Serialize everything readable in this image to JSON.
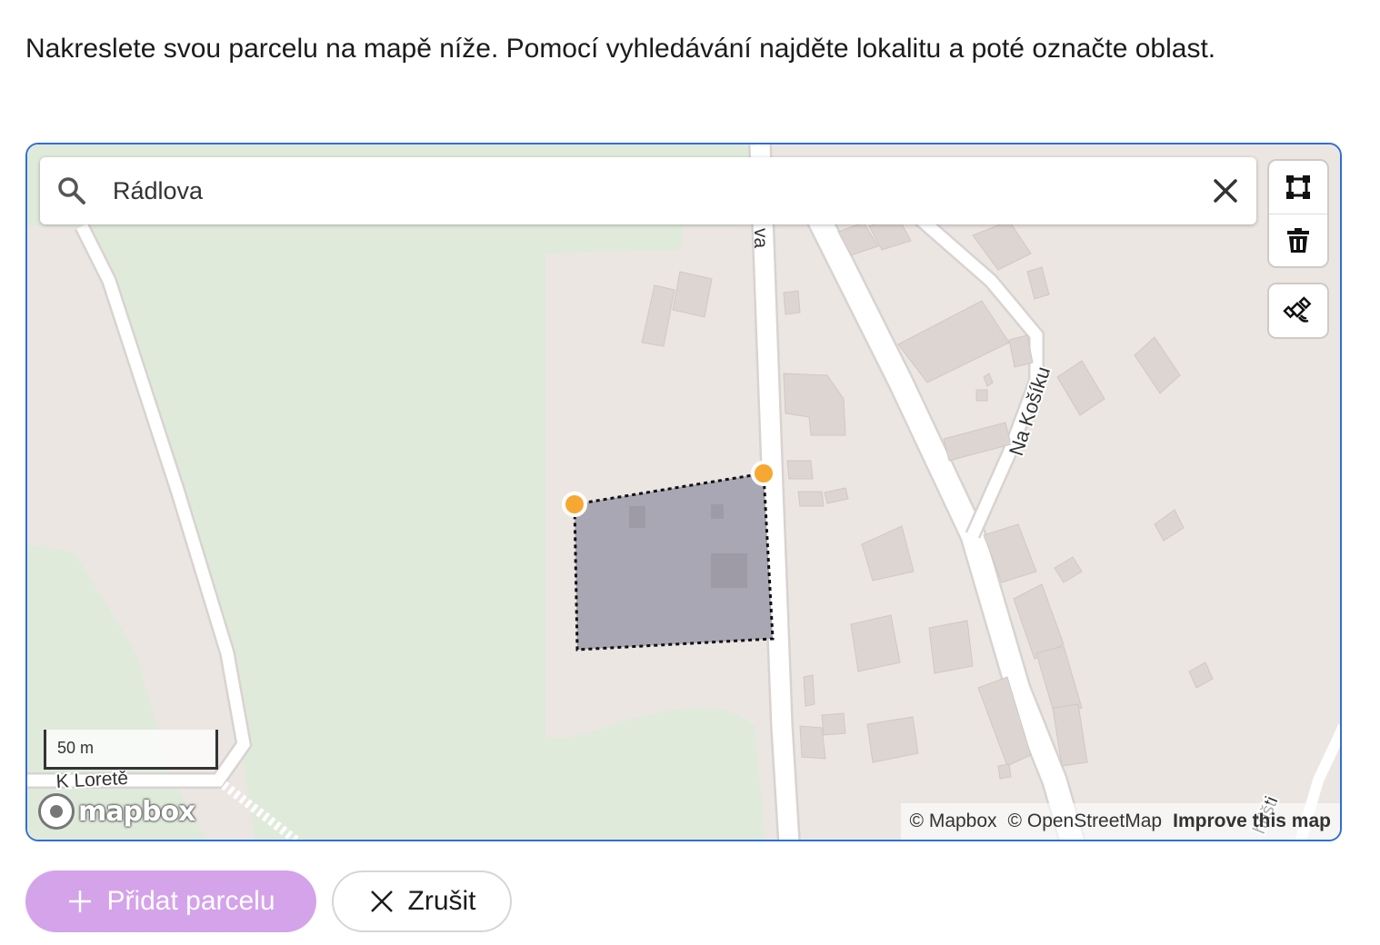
{
  "instructions": "Nakreslete svou parcelu na mapě níže. Pomocí vyhledávání najděte lokalitu a poté označte oblast.",
  "map": {
    "search": {
      "value": "Rádlova",
      "placeholder": ""
    },
    "controls": {
      "polygon_tool_icon": "polygon-draw-icon",
      "trash_icon": "trash-icon",
      "satellite_toggle_icon": "satellite-icon"
    },
    "street_labels": {
      "radlova_partial": "va",
      "na_kosiku": "Na Košíku",
      "k_lorete": "K Loretě",
      "bottom_right_partial": "hřišti"
    },
    "scale_label": "50 m",
    "logo_text": "mapbox",
    "attribution": {
      "mapbox": "© Mapbox",
      "osm": "© OpenStreetMap",
      "improve": "Improve this map"
    },
    "colors": {
      "frame": "#2f6fd6",
      "land": "#ece6e3",
      "park": "#dfeadb",
      "road": "#ffffff",
      "building": "#ddd5d2",
      "polygon_fill": "#a9a7b3",
      "vertex": "#f7a832"
    }
  },
  "buttons": {
    "add_parcel": "Přidat parcelu",
    "cancel": "Zrušit"
  }
}
